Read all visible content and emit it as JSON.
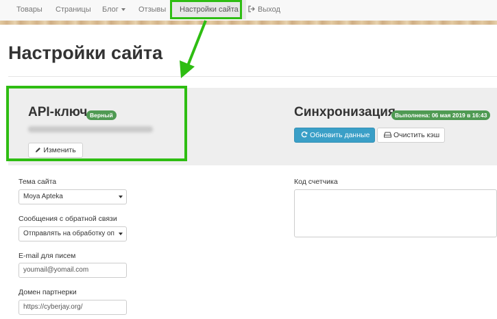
{
  "nav": {
    "items": [
      {
        "label": "Товары"
      },
      {
        "label": "Страницы"
      },
      {
        "label": "Блог"
      },
      {
        "label": "Отзывы"
      },
      {
        "label": "Настройки сайта"
      },
      {
        "label": "Выход"
      }
    ],
    "active": "Настройки сайта"
  },
  "page": {
    "title": "Настройки сайта"
  },
  "api": {
    "title": "API-ключ",
    "status_badge": "Верный",
    "edit_label": "Изменить"
  },
  "sync": {
    "title": "Синхронизация",
    "status_badge": "Выполнена: 06 мая 2019 в 16:43",
    "refresh_label": "Обновить данные",
    "clear_cache_label": "Очистить кэш"
  },
  "form": {
    "theme": {
      "label": "Тема сайта",
      "value": "Moya Apteka"
    },
    "feedback": {
      "label": "Сообщения с обратной связи",
      "value": "Отправлять на обработку оп"
    },
    "email": {
      "label": "E-mail для писем",
      "value": "youmail@yomail.com"
    },
    "partner_domain": {
      "label": "Домен партнерки",
      "value": "https://cyberjay.org/"
    },
    "counter_code": {
      "label": "Код счетчика",
      "value": ""
    }
  },
  "colors": {
    "highlight": "#2ebd12",
    "badge": "#4f9a53",
    "primary_button": "#3a9fc7"
  },
  "icons": [
    "caret-down-icon",
    "exit-icon",
    "pencil-icon",
    "refresh-icon",
    "drive-icon"
  ]
}
